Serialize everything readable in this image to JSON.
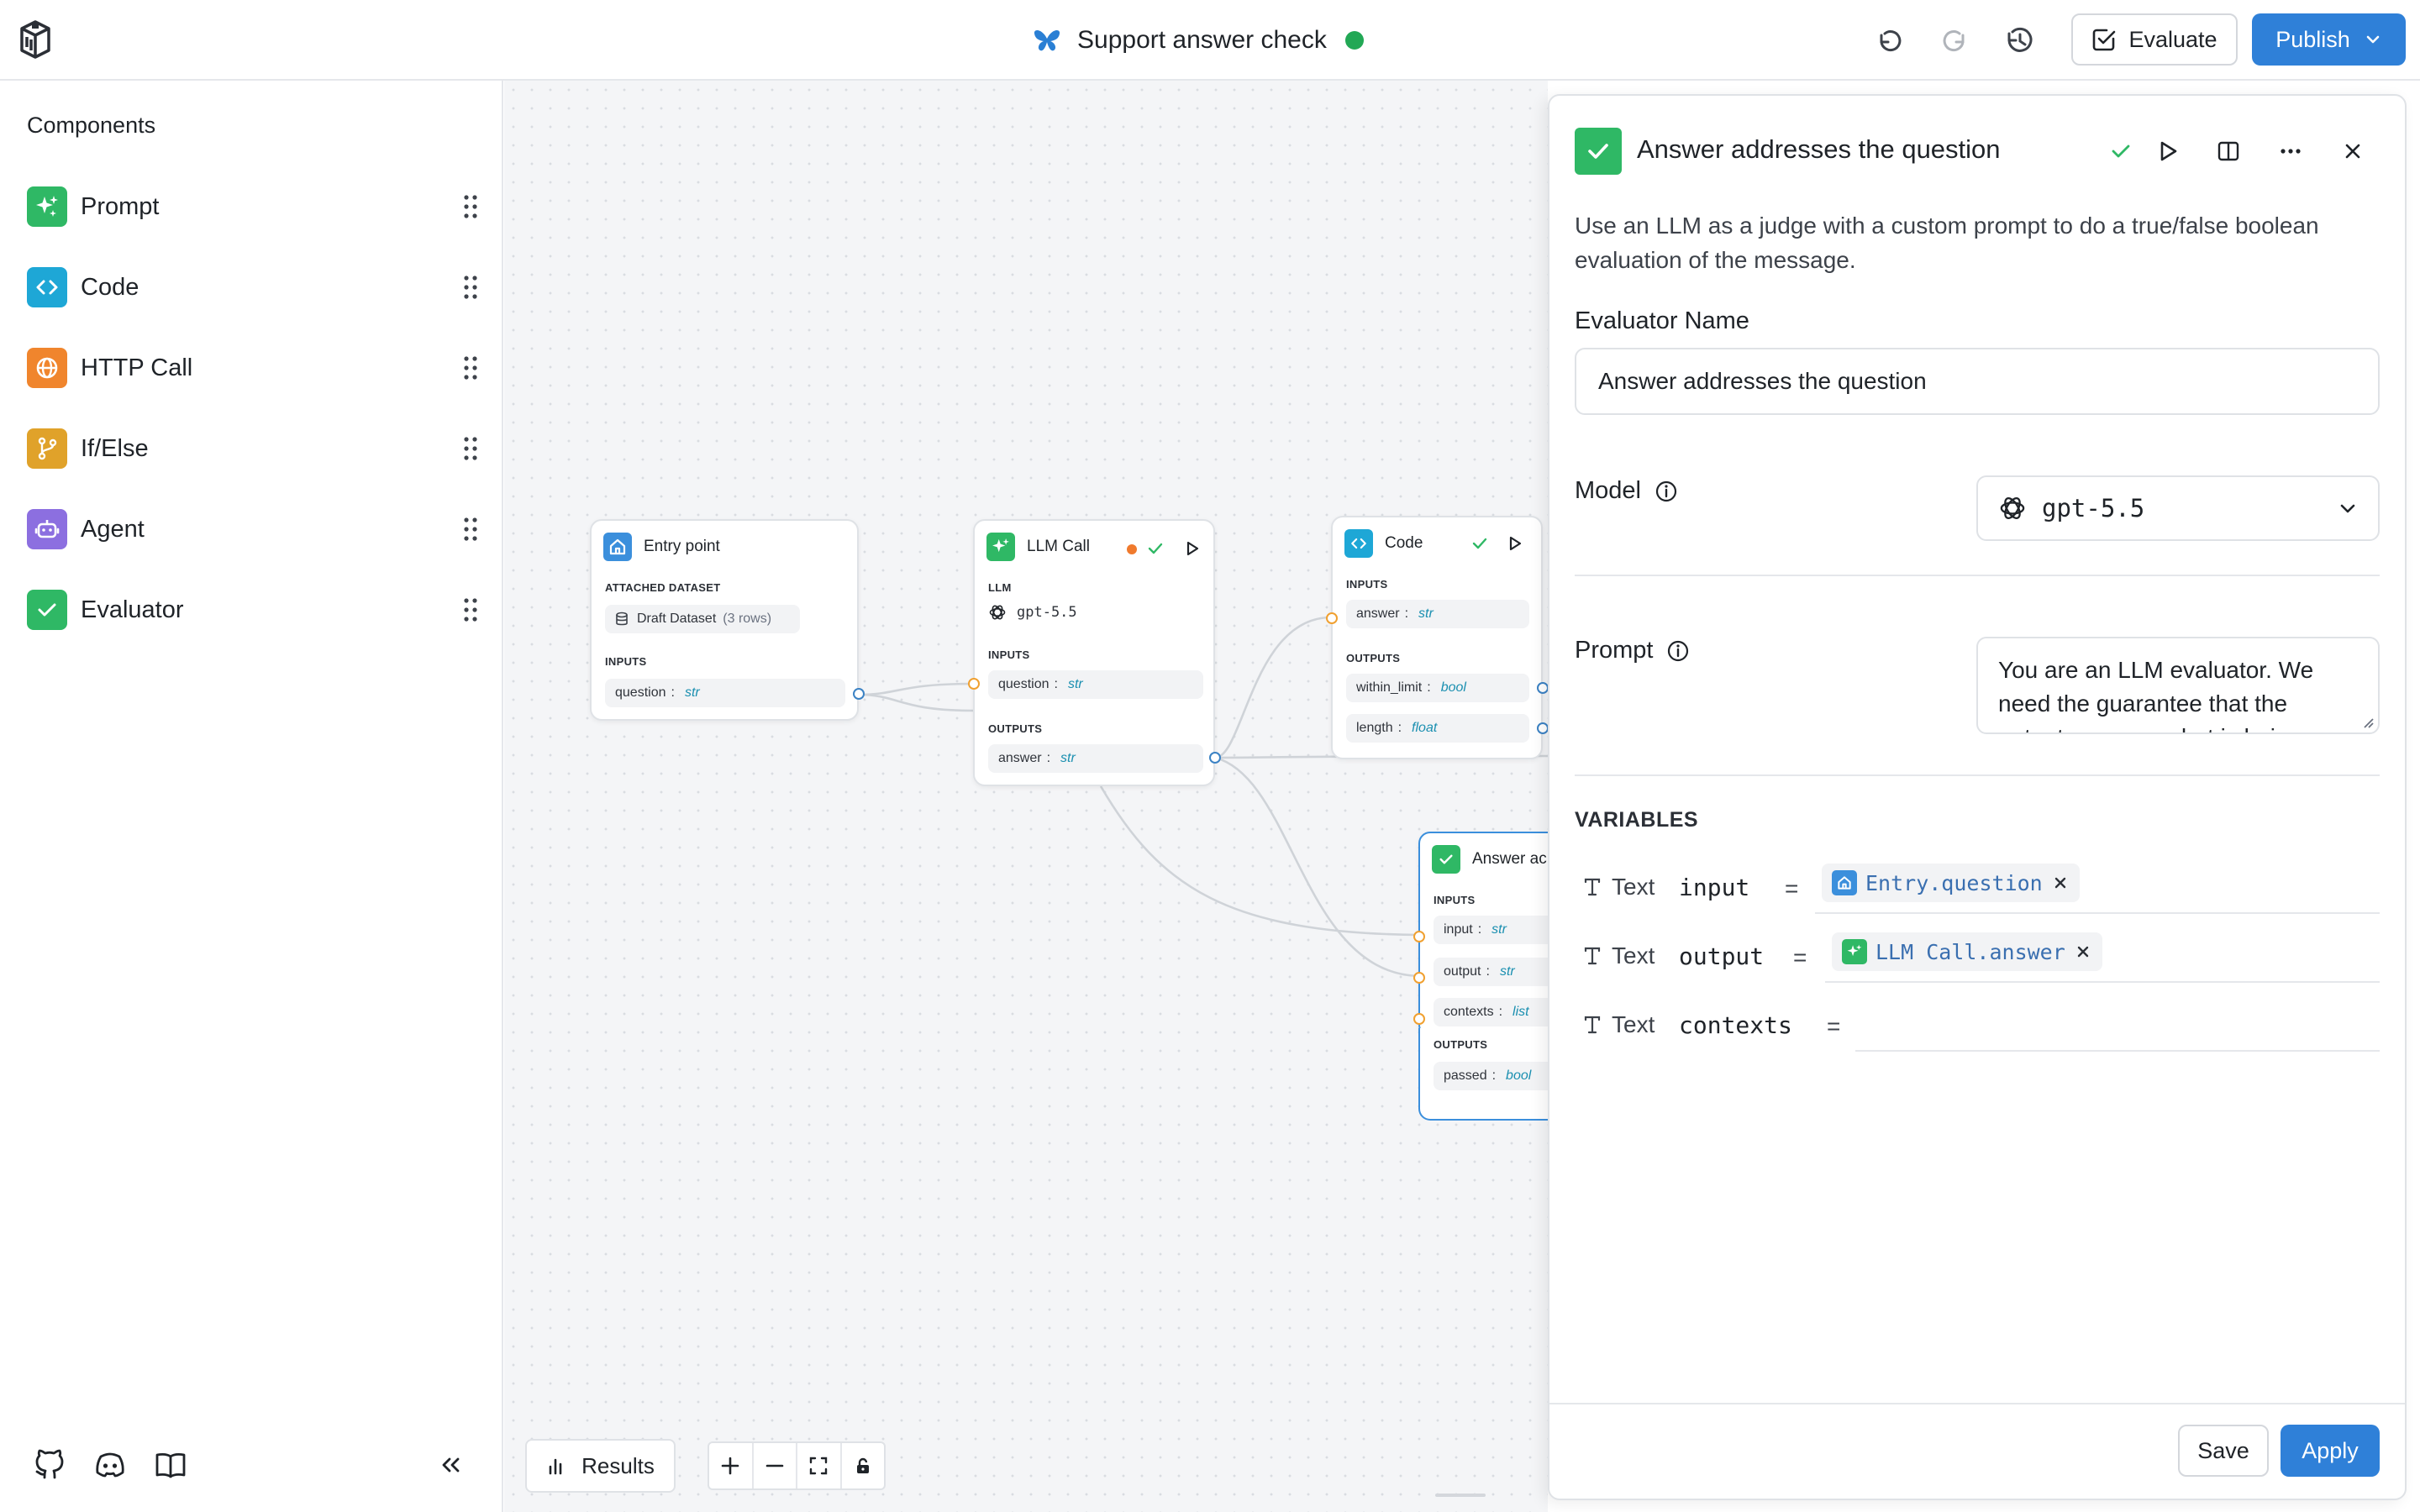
{
  "header": {
    "title": "Support answer check",
    "evaluate_label": "Evaluate",
    "publish_label": "Publish",
    "status_color": "#22a855",
    "accent_color": "#2f80d8"
  },
  "sidebar": {
    "title": "Components",
    "items": [
      {
        "label": "Prompt",
        "icon": "sparkles-icon",
        "color": "#2fb865"
      },
      {
        "label": "Code",
        "icon": "code-icon",
        "color": "#1ea7d6"
      },
      {
        "label": "HTTP Call",
        "icon": "globe-icon",
        "color": "#f0852d"
      },
      {
        "label": "If/Else",
        "icon": "branch-icon",
        "color": "#e0a22a"
      },
      {
        "label": "Agent",
        "icon": "robot-icon",
        "color": "#8c6fe0"
      },
      {
        "label": "Evaluator",
        "icon": "check-icon",
        "color": "#2fb865"
      }
    ]
  },
  "canvas": {
    "entry": {
      "title": "Entry point",
      "section_dataset": "ATTACHED DATASET",
      "dataset_name": "Draft Dataset",
      "dataset_rows": "(3 rows)",
      "section_inputs": "INPUTS",
      "input_name": "question",
      "input_type": "str"
    },
    "llm": {
      "title": "LLM Call",
      "section_llm": "LLM",
      "model": "gpt-5.5",
      "section_inputs": "INPUTS",
      "input_name": "question",
      "input_type": "str",
      "section_outputs": "OUTPUTS",
      "output_name": "answer",
      "output_type": "str"
    },
    "code": {
      "title": "Code",
      "section_inputs": "INPUTS",
      "input_name": "answer",
      "input_type": "str",
      "section_outputs": "OUTPUTS",
      "outputs": [
        {
          "name": "within_limit",
          "type": "bool"
        },
        {
          "name": "length",
          "type": "float"
        }
      ]
    },
    "evaluator": {
      "title": "Answer ac",
      "section_inputs": "INPUTS",
      "inputs": [
        {
          "name": "input",
          "type": "str"
        },
        {
          "name": "output",
          "type": "str"
        },
        {
          "name": "contexts",
          "type": "list"
        }
      ],
      "section_outputs": "OUTPUTS",
      "output_name": "passed",
      "output_type": "bool"
    },
    "results_label": "Results"
  },
  "panel": {
    "title": "Answer addresses the question",
    "description": "Use an LLM as a judge with a custom prompt to do a true/false boolean evaluation of the message.",
    "name_label": "Evaluator Name",
    "name_value": "Answer addresses the question",
    "model_label": "Model",
    "model_value": "gpt-5.5",
    "prompt_label": "Prompt",
    "prompt_value": "You are an LLM evaluator. We need the guarantee that the output answers what is being",
    "variables_title": "VARIABLES",
    "variables": [
      {
        "type": "Text",
        "name": "input",
        "value": "Entry.question"
      },
      {
        "type": "Text",
        "name": "output",
        "value": "LLM Call.answer"
      },
      {
        "type": "Text",
        "name": "contexts",
        "value": ""
      }
    ],
    "save_label": "Save",
    "apply_label": "Apply"
  }
}
